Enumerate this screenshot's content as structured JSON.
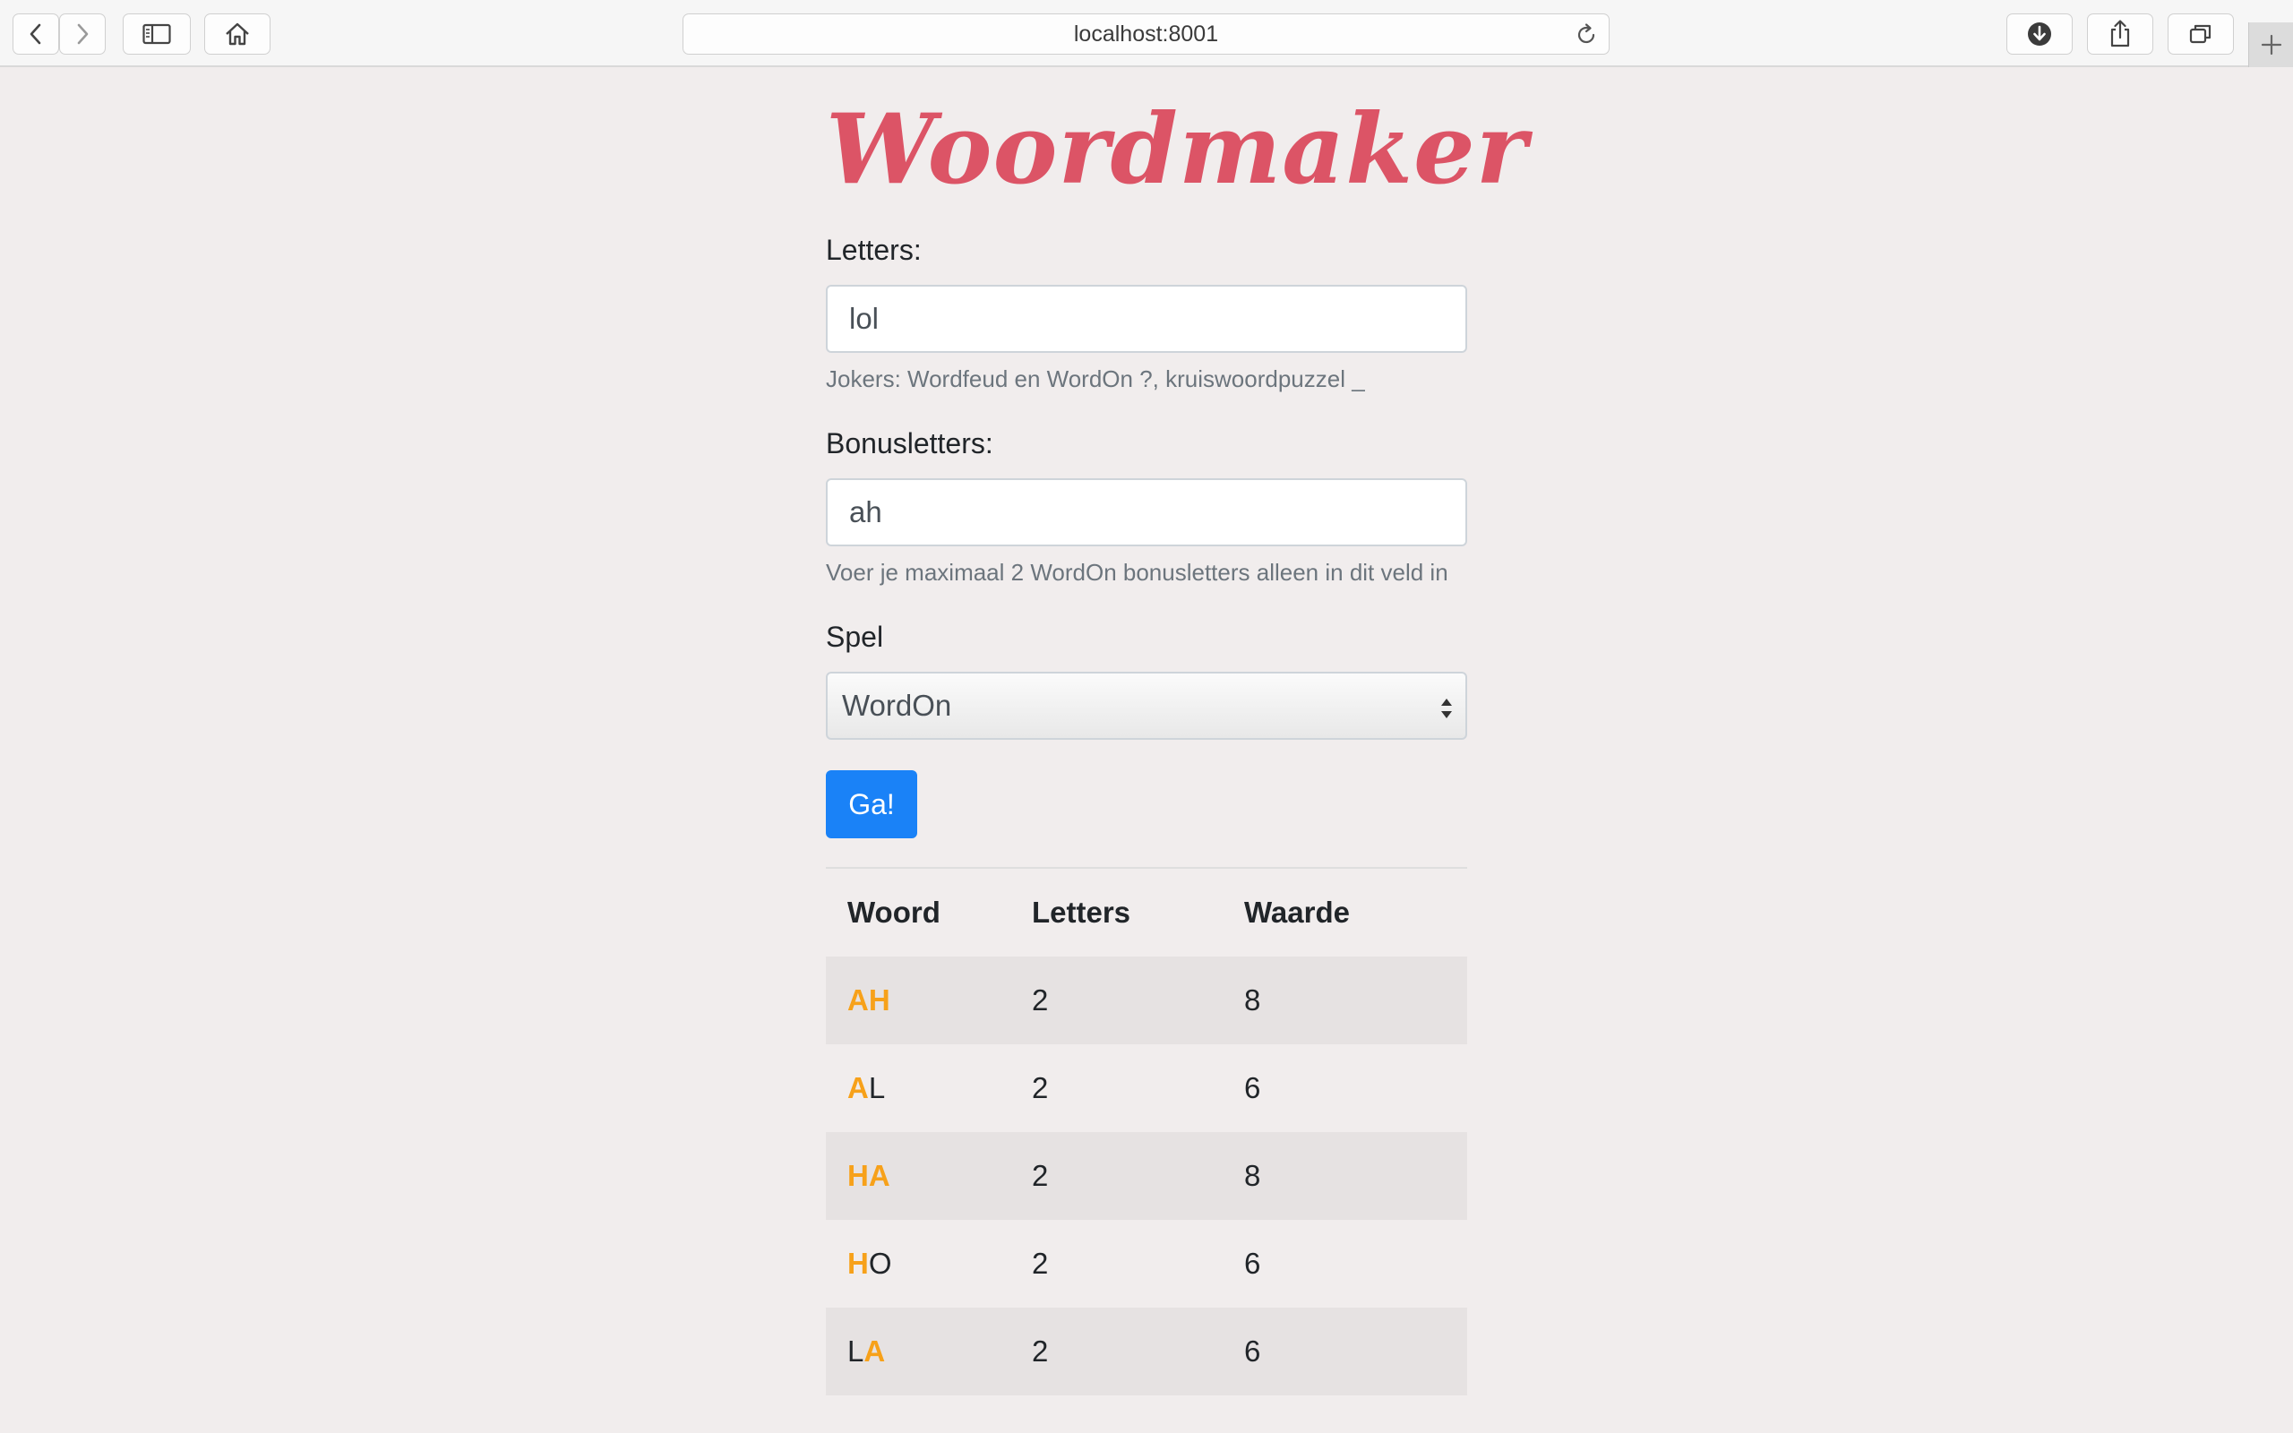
{
  "browser": {
    "url": "localhost:8001"
  },
  "page": {
    "title": "Woordmaker",
    "letters_label": "Letters:",
    "letters_value": "lol",
    "letters_help": "Jokers: Wordfeud en WordOn ?, kruiswoordpuzzel _",
    "bonus_label": "Bonusletters:",
    "bonus_value": "ah",
    "bonus_help": "Voer je maximaal 2 WordOn bonusletters alleen in dit veld in",
    "game_label": "Spel",
    "game_selected": "WordOn",
    "submit_label": "Ga!"
  },
  "results": {
    "headers": [
      "Woord",
      "Letters",
      "Waarde"
    ],
    "rows": [
      {
        "word": [
          {
            "ch": "A",
            "bonus": true
          },
          {
            "ch": "H",
            "bonus": true
          }
        ],
        "letters": "2",
        "value": "8"
      },
      {
        "word": [
          {
            "ch": "A",
            "bonus": true
          },
          {
            "ch": "L",
            "bonus": false
          }
        ],
        "letters": "2",
        "value": "6"
      },
      {
        "word": [
          {
            "ch": "H",
            "bonus": true
          },
          {
            "ch": "A",
            "bonus": true
          }
        ],
        "letters": "2",
        "value": "8"
      },
      {
        "word": [
          {
            "ch": "H",
            "bonus": true
          },
          {
            "ch": "O",
            "bonus": false
          }
        ],
        "letters": "2",
        "value": "6"
      },
      {
        "word": [
          {
            "ch": "L",
            "bonus": false
          },
          {
            "ch": "A",
            "bonus": true
          }
        ],
        "letters": "2",
        "value": "6"
      }
    ]
  },
  "colors": {
    "title": "#dc5466",
    "bonus_letter": "#f7a11a",
    "button": "#1a82f7"
  }
}
